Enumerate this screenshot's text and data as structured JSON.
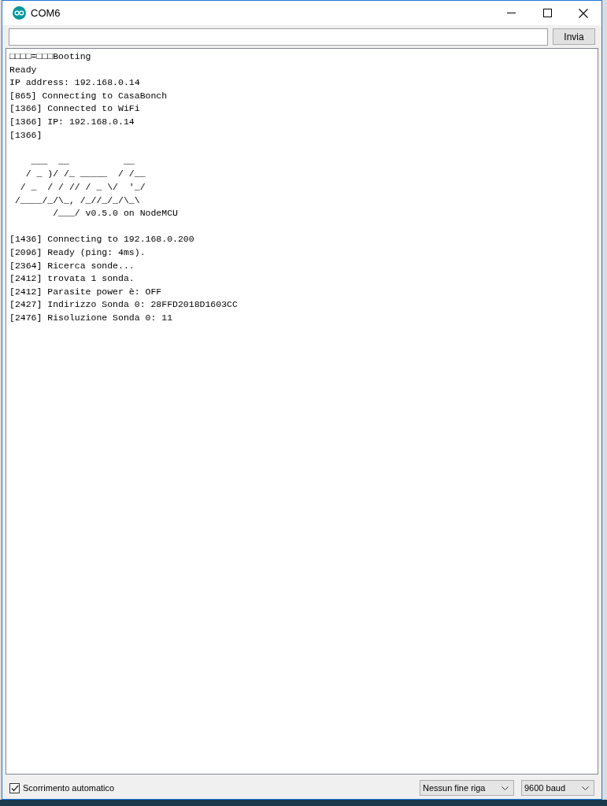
{
  "window": {
    "title": "COM6"
  },
  "send": {
    "button": "Invia"
  },
  "log_before": [
    "□□□□=□□□Booting",
    "Ready",
    "IP address: 192.168.0.14",
    "[865] Connecting to CasaBonch",
    "[1366] Connected to WiFi",
    "[1366] IP: 192.168.0.14",
    "[1366]"
  ],
  "ascii_logo": [
    "    ___  __          __",
    "   / _ )/ /_ _____  / /__",
    "  / _  / / // / _ \\/  '_/",
    " /____/_/\\_, /_//_/_/\\_\\",
    "        /___/ v0.5.0 on NodeMCU"
  ],
  "log_after": [
    "[1436] Connecting to 192.168.0.200",
    "[2096] Ready (ping: 4ms).",
    "[2364] Ricerca sonde...",
    "[2412] trovata 1 sonda.",
    "[2412] Parasite power è: OFF",
    "[2427] Indirizzo Sonda 0: 28FFD2018D1603CC",
    "[2476] Risoluzione Sonda 0: 11"
  ],
  "autoscroll": {
    "label": "Scorrimento automatico",
    "checked": true
  },
  "line_ending": {
    "value": "Nessun fine riga"
  },
  "baud": {
    "value": "9600 baud"
  }
}
